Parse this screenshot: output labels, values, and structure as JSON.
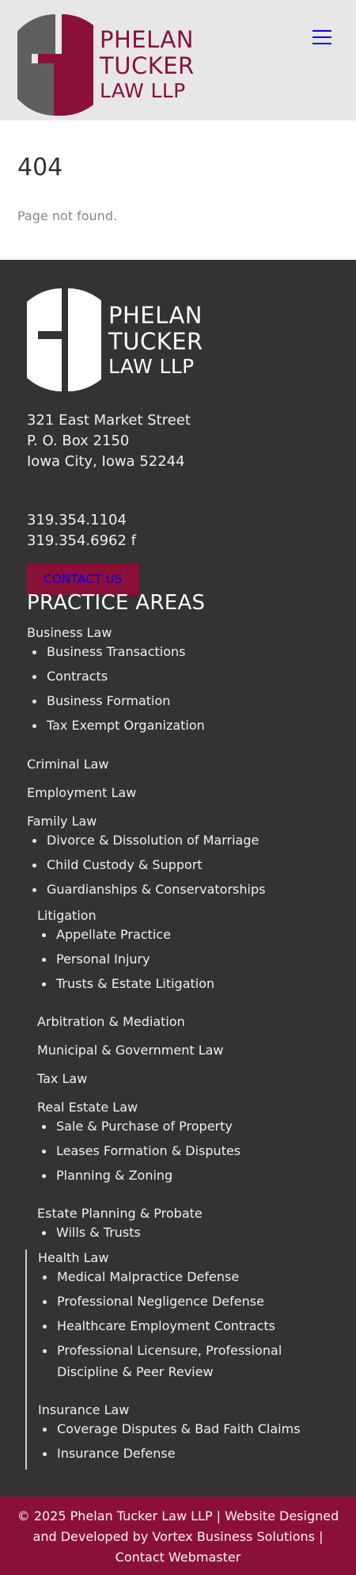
{
  "brand": {
    "line1": "PHELAN",
    "line2": "TUCKER",
    "line3": "LAW LLP",
    "accent_color": "#8b1038",
    "header_bg": "#e7e7e7",
    "footer_bg": "#333333"
  },
  "header": {
    "menu_icon": "hamburger-menu-icon"
  },
  "main": {
    "code": "404",
    "message": "Page not found."
  },
  "footer": {
    "address": [
      "321 East Market Street",
      "P. O. Box 2150",
      "Iowa City, Iowa 52244"
    ],
    "phone": "319.354.1104",
    "fax": "319.354.6962 f",
    "contact_label": "CONTACT US",
    "practice_title": "PRACTICE AREAS",
    "areas": [
      {
        "label": "Business Law",
        "children": [
          "Business Transactions",
          "Contracts",
          "Business Formation",
          "Tax Exempt Organization"
        ]
      },
      {
        "label": "Criminal Law",
        "children": []
      },
      {
        "label": "Employment Law",
        "children": []
      },
      {
        "label": "Family Law",
        "children": [
          "Divorce & Dissolution of Marriage",
          "Child Custody & Support",
          "Guardianships & Conservatorships"
        ]
      },
      {
        "label": "Litigation",
        "children": [
          "Appellate Practice",
          "Personal Injury",
          "Trusts & Estate Litigation"
        ]
      },
      {
        "label": "Arbitration & Mediation",
        "children": []
      },
      {
        "label": "Municipal & Government Law",
        "children": []
      },
      {
        "label": "Tax Law",
        "children": []
      },
      {
        "label": "Real Estate Law",
        "children": [
          "Sale & Purchase of Property",
          "Leases Formation & Disputes",
          "Planning & Zoning"
        ]
      },
      {
        "label": "Estate Planning & Probate",
        "children": [
          "Wills & Trusts"
        ]
      },
      {
        "label": "Health Law",
        "children": [
          "Medical Malpractice Defense",
          "Professional Negligence Defense",
          "Healthcare Employment Contracts",
          "Professional Licensure, Professional",
          "Discipline & Peer Review"
        ]
      },
      {
        "label": "Insurance Law",
        "children": [
          "Coverage Disputes & Bad Faith Claims",
          "Insurance Defense"
        ]
      }
    ]
  },
  "copyright": {
    "line1": "© 2025 Phelan Tucker Law LLP | Website Designed",
    "line2": "and Developed by Vortex Business Solutions |",
    "line3": "Contact Webmaster"
  }
}
